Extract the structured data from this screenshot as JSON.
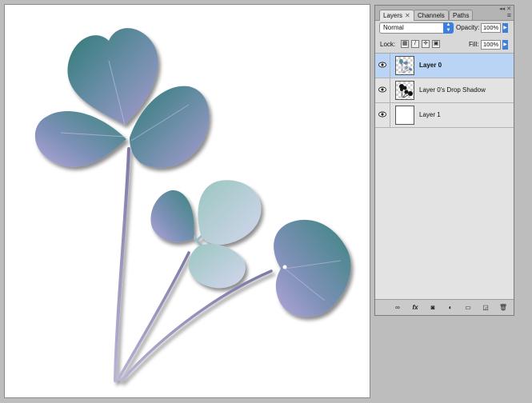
{
  "canvas": {
    "artwork": "pressed-leaf-sprig"
  },
  "layers_panel": {
    "tabs": [
      {
        "label": "Layers",
        "active": true,
        "close": "✕"
      },
      {
        "label": "Channels",
        "active": false
      },
      {
        "label": "Paths",
        "active": false
      }
    ],
    "collapse_glyph": "◂◂ ✕",
    "menu_icon": "panel-menu-icon",
    "blend_mode": "Normal",
    "opacity_label": "Opacity:",
    "opacity_value": "100%",
    "lock_label": "Lock:",
    "fill_label": "Fill:",
    "fill_value": "100%",
    "layers": [
      {
        "name": "Layer 0",
        "selected": true,
        "visible": true,
        "thumb": "leaf-thumbnail"
      },
      {
        "name": "Layer 0's Drop Shadow",
        "selected": false,
        "visible": true,
        "thumb": "shadow-thumbnail"
      },
      {
        "name": "Layer 1",
        "selected": false,
        "visible": true,
        "thumb": "white-fill-thumbnail"
      }
    ],
    "bottom_icons": [
      "link-layers-icon",
      "fx-icon",
      "layer-mask-icon",
      "adjustment-layer-icon",
      "group-folder-icon",
      "new-layer-icon",
      "trash-icon"
    ],
    "fx_label": "fx"
  },
  "colors": {
    "selection": "#b9d4f4",
    "accent_blue": "#3f7fdc",
    "leaf_teal": "#4f8f8c",
    "leaf_violet": "#8f84bd"
  }
}
